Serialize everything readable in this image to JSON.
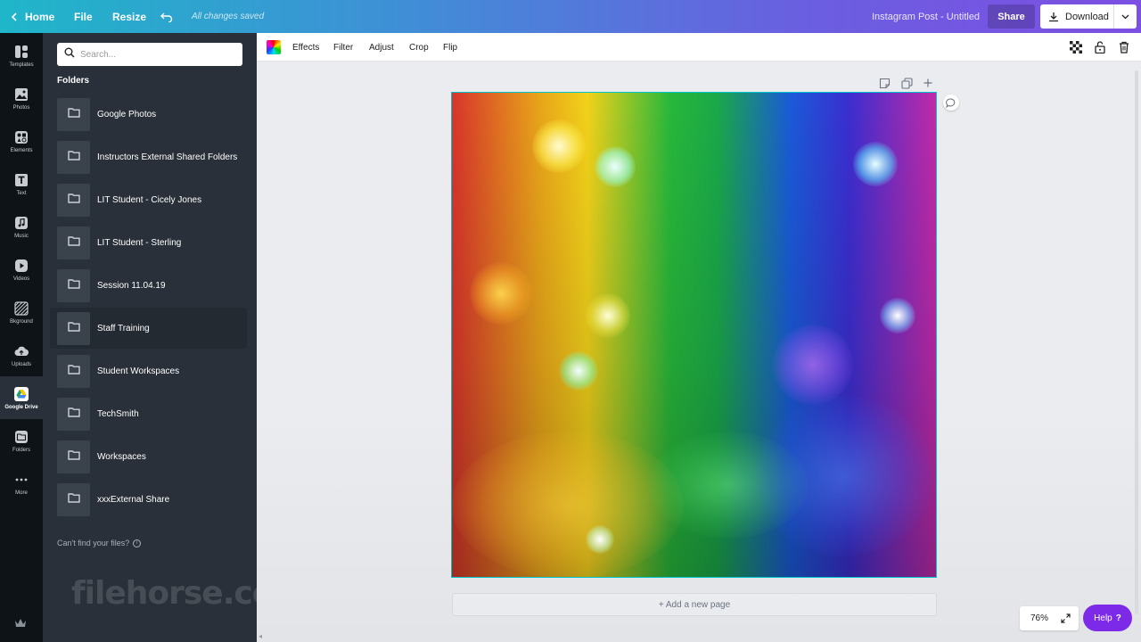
{
  "topbar": {
    "home_label": "Home",
    "file_label": "File",
    "resize_label": "Resize",
    "save_status": "All changes saved",
    "design_title": "Instagram Post - Untitled",
    "share_label": "Share",
    "download_label": "Download"
  },
  "rail": {
    "items": [
      {
        "label": "Templates",
        "icon": "templates-icon"
      },
      {
        "label": "Photos",
        "icon": "photos-icon"
      },
      {
        "label": "Elements",
        "icon": "elements-icon"
      },
      {
        "label": "Text",
        "icon": "text-icon"
      },
      {
        "label": "Music",
        "icon": "music-icon"
      },
      {
        "label": "Videos",
        "icon": "videos-icon"
      },
      {
        "label": "Bkground",
        "icon": "background-icon"
      },
      {
        "label": "Uploads",
        "icon": "uploads-icon"
      },
      {
        "label": "Google Drive",
        "icon": "google-drive-icon"
      },
      {
        "label": "Folders",
        "icon": "folders-icon"
      },
      {
        "label": "More",
        "icon": "more-icon"
      }
    ],
    "active": "Google Drive"
  },
  "panel": {
    "search_placeholder": "Search...",
    "folders_heading": "Folders",
    "folders": [
      "Google Photos",
      "Instructors External Shared Folders",
      "LIT Student - Cicely Jones",
      "LIT Student - Sterling",
      "Session 11.04.19",
      "Staff Training",
      "Student Workspaces",
      "TechSmith",
      "Workspaces",
      "xxxExternal Share"
    ],
    "hovered_folder": "Staff Training",
    "cant_find": "Can't find your files?",
    "watermark": "filehorse.com"
  },
  "toolbar": {
    "effects": "Effects",
    "filter": "Filter",
    "adjust": "Adjust",
    "crop": "Crop",
    "flip": "Flip"
  },
  "canvas": {
    "add_page": "+ Add a new page",
    "zoom": "76%",
    "help": "Help",
    "help_mark": "?",
    "selection_color": "#00c4cc",
    "image_description_colors": [
      "#d8342b",
      "#f2d21a",
      "#28b83a",
      "#1a5ad8",
      "#c02aa8"
    ]
  },
  "colors": {
    "accent": "#7d2ae8",
    "panel_bg": "#293039",
    "rail_bg": "#0e1318"
  }
}
